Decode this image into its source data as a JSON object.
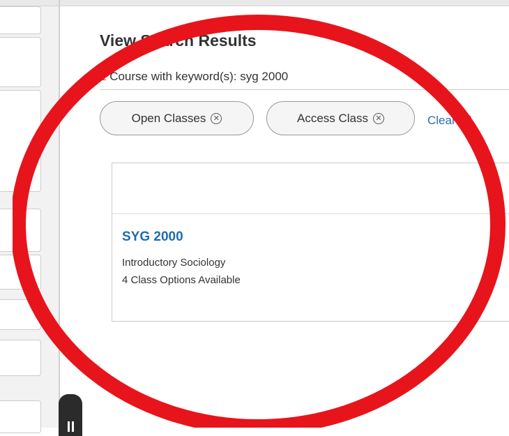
{
  "header": {
    "title": "View Search Results"
  },
  "summary": {
    "count": "1",
    "text": " Course with keyword(s): syg 2000"
  },
  "filters": {
    "chips": [
      {
        "label": "Open Classes",
        "remove_icon": "close-circle-icon"
      },
      {
        "label": "Access Class",
        "remove_icon": "close-circle-icon"
      }
    ],
    "clear_label": "Clear All"
  },
  "results": [
    {
      "code": "SYG 2000",
      "title": "Introductory Sociology",
      "options": "4 Class Options Available"
    }
  ],
  "annotation": {
    "shape": "ellipse",
    "color": "#e8141b"
  },
  "colors": {
    "link": "#2a6db0",
    "course_code": "#1f6bb0",
    "count_accent": "#b5532a"
  }
}
